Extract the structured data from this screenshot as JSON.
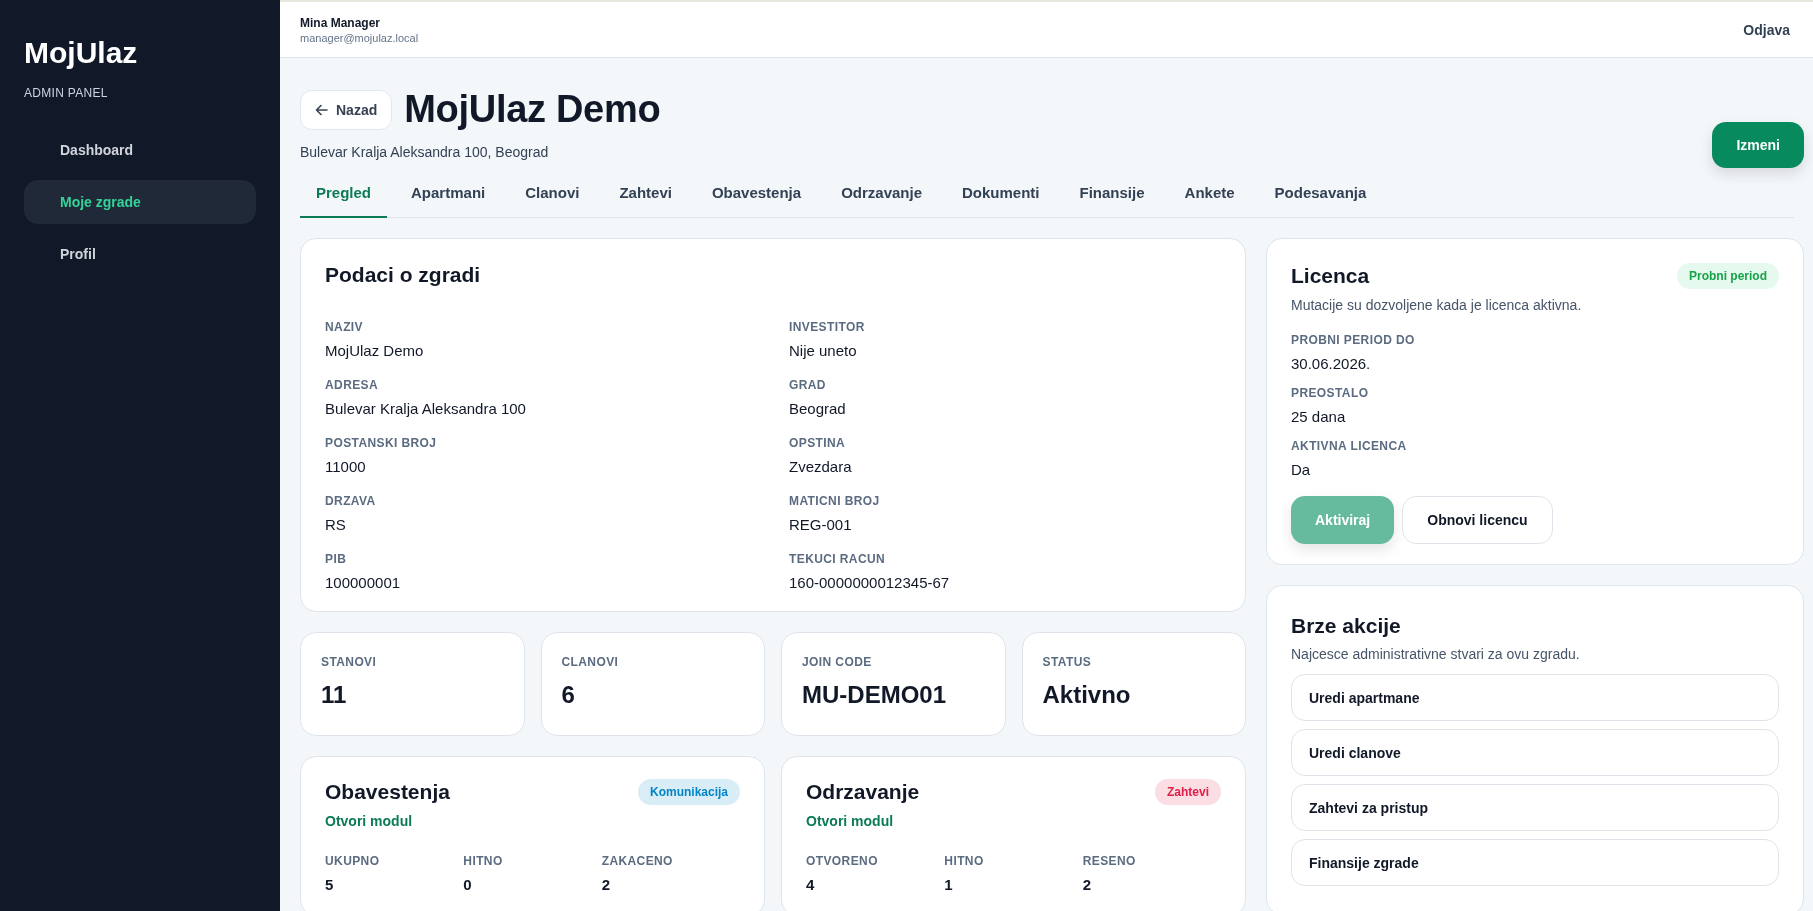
{
  "sidebar": {
    "logo": "MojUlaz",
    "subtitle": "ADMIN PANEL",
    "items": [
      {
        "label": "Dashboard",
        "selected": false
      },
      {
        "label": "Moje zgrade",
        "selected": true
      },
      {
        "label": "Profil",
        "selected": false
      }
    ]
  },
  "header": {
    "user_name": "Mina Manager",
    "user_email": "manager@mojulaz.local",
    "logout": "Odjava"
  },
  "page": {
    "back": "Nazad",
    "title": "MojUlaz Demo",
    "address": "Bulevar Kralja Aleksandra 100, Beograd",
    "edit": "Izmeni"
  },
  "tabs": [
    {
      "label": "Pregled",
      "selected": true
    },
    {
      "label": "Apartmani",
      "selected": false
    },
    {
      "label": "Clanovi",
      "selected": false
    },
    {
      "label": "Zahtevi",
      "selected": false
    },
    {
      "label": "Obavestenja",
      "selected": false
    },
    {
      "label": "Odrzavanje",
      "selected": false
    },
    {
      "label": "Dokumenti",
      "selected": false
    },
    {
      "label": "Finansije",
      "selected": false
    },
    {
      "label": "Ankete",
      "selected": false
    },
    {
      "label": "Podesavanja",
      "selected": false
    }
  ],
  "building": {
    "title": "Podaci o zgradi",
    "fields": [
      {
        "label": "NAZIV",
        "value": "MojUlaz Demo"
      },
      {
        "label": "INVESTITOR",
        "value": "Nije uneto"
      },
      {
        "label": "ADRESA",
        "value": "Bulevar Kralja Aleksandra 100"
      },
      {
        "label": "GRAD",
        "value": "Beograd"
      },
      {
        "label": "POSTANSKI BROJ",
        "value": "11000"
      },
      {
        "label": "OPSTINA",
        "value": "Zvezdara"
      },
      {
        "label": "DRZAVA",
        "value": "RS"
      },
      {
        "label": "MATICNI BROJ",
        "value": "REG-001"
      },
      {
        "label": "PIB",
        "value": "100000001"
      },
      {
        "label": "TEKUCI RACUN",
        "value": "160-0000000012345-67"
      }
    ]
  },
  "stats": [
    {
      "label": "STANOVI",
      "value": "11"
    },
    {
      "label": "CLANOVI",
      "value": "6"
    },
    {
      "label": "JOIN CODE",
      "value": "MU-DEMO01"
    },
    {
      "label": "STATUS",
      "value": "Aktivno"
    }
  ],
  "modules": [
    {
      "title": "Obavestenja",
      "badge": "Komunikacija",
      "color": "#0284c7",
      "link": "Otvori modul",
      "metrics": [
        {
          "label": "UKUPNO",
          "value": "5"
        },
        {
          "label": "HITNO",
          "value": "0"
        },
        {
          "label": "ZAKACENO",
          "value": "2"
        }
      ]
    },
    {
      "title": "Odrzavanje",
      "badge": "Zahtevi",
      "color": "#e11d48",
      "link": "Otvori modul",
      "metrics": [
        {
          "label": "OTVORENO",
          "value": "4"
        },
        {
          "label": "HITNO",
          "value": "1"
        },
        {
          "label": "RESENO",
          "value": "2"
        }
      ]
    }
  ],
  "license": {
    "title": "Licenca",
    "badge": "Probni period",
    "description": "Mutacije su dozvoljene kada je licenca aktivna.",
    "fields": [
      {
        "label": "PROBNI PERIOD DO",
        "value": "30.06.2026."
      },
      {
        "label": "PREOSTALO",
        "value": "25 dana"
      },
      {
        "label": "AKTIVNA LICENCA",
        "value": "Da"
      }
    ],
    "activate": {
      "label": "Aktiviraj",
      "disabled": true
    },
    "renew": "Obnovi licencu"
  },
  "quick_actions": {
    "title": "Brze akcije",
    "description": "Najcesce administrativne stvari za ovu zgradu.",
    "items": [
      "Uredi apartmane",
      "Uredi clanove",
      "Zahtevi za pristup",
      "Finansije zgrade"
    ]
  }
}
